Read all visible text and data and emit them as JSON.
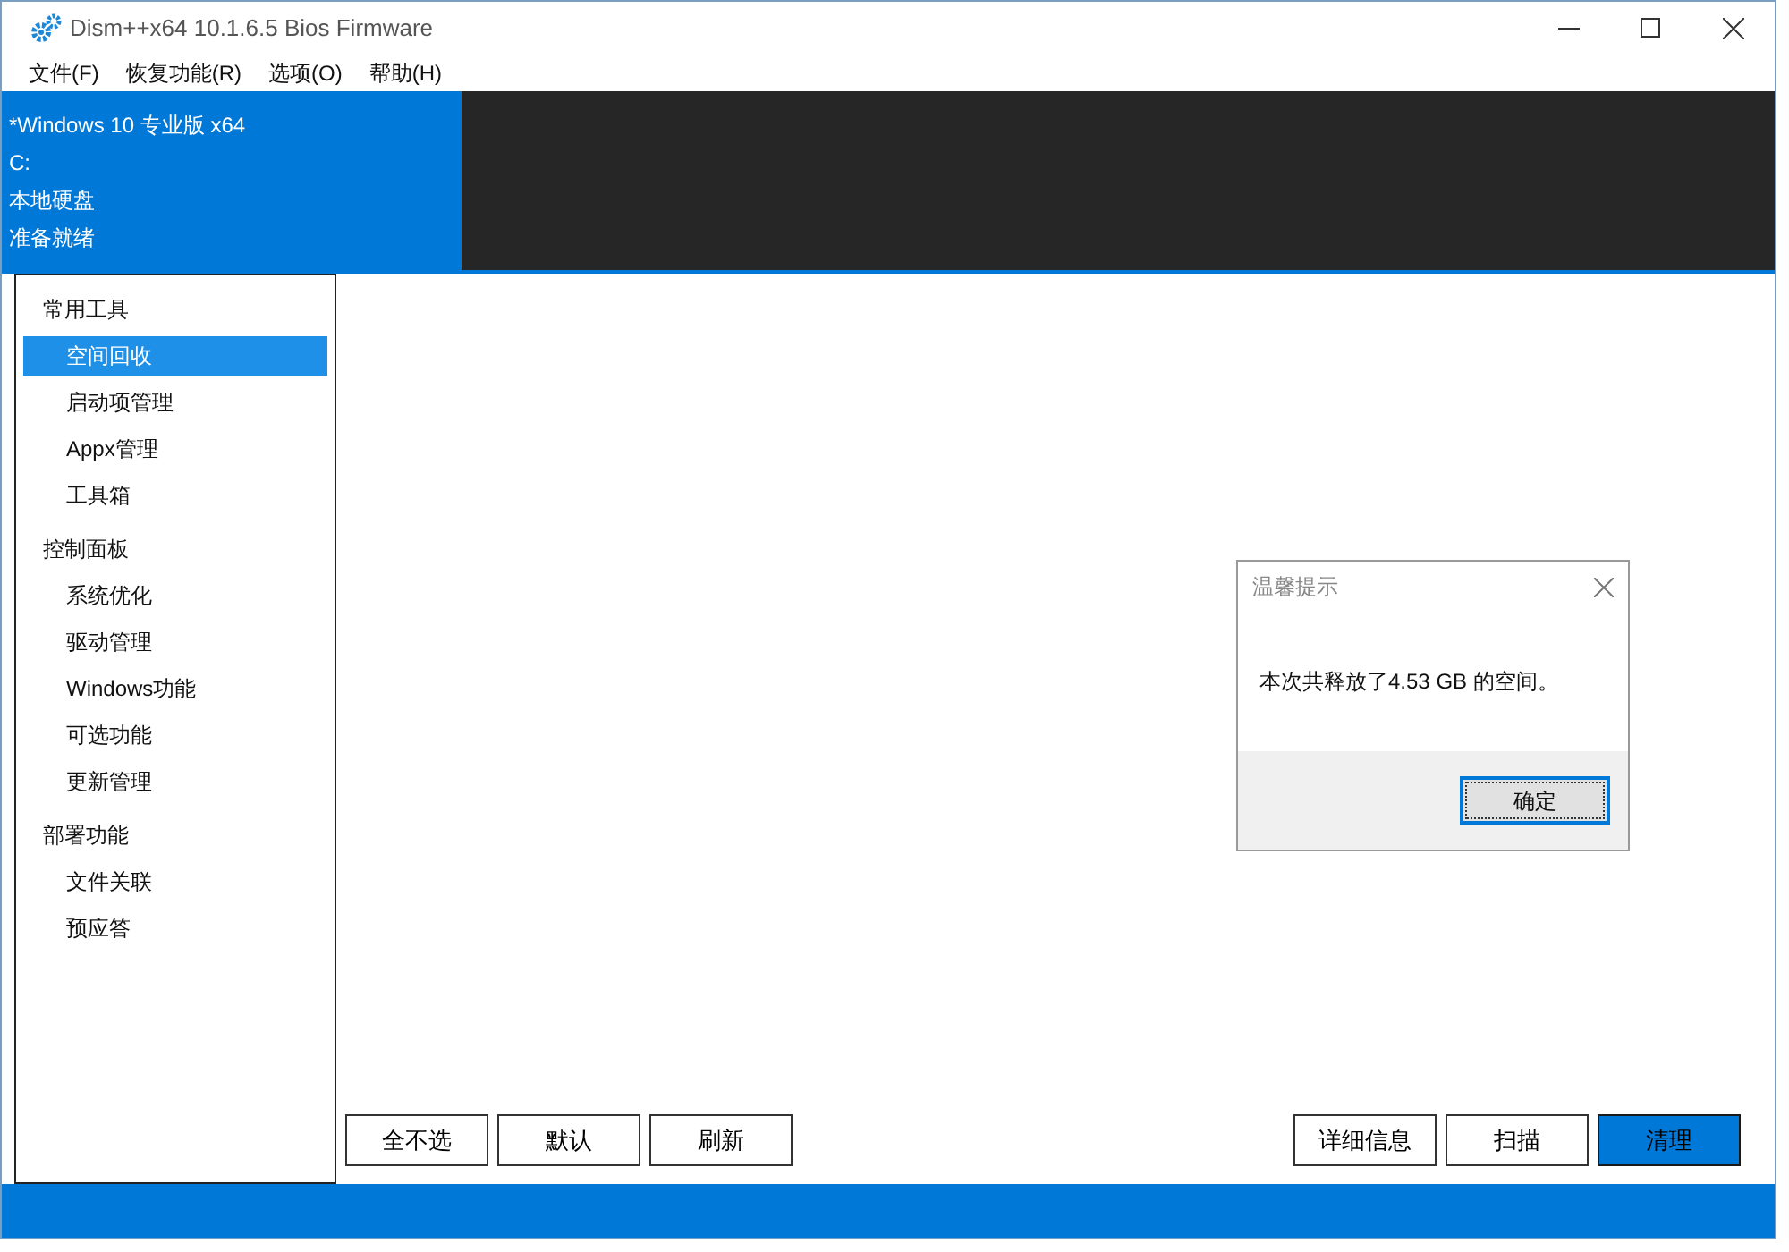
{
  "window": {
    "title": "Dism++x64 10.1.6.5 Bios Firmware"
  },
  "menu": [
    "文件(F)",
    "恢复功能(R)",
    "选项(O)",
    "帮助(H)"
  ],
  "image_info": [
    "*Windows 10 专业版 x64",
    "C:",
    "本地硬盘",
    "准备就绪"
  ],
  "sidebar": [
    {
      "label": "常用工具",
      "children": [
        {
          "label": "空间回收",
          "selected": true
        },
        {
          "label": "启动项管理",
          "selected": false
        },
        {
          "label": "Appx管理",
          "selected": false
        },
        {
          "label": "工具箱",
          "selected": false
        }
      ]
    },
    {
      "label": "控制面板",
      "children": [
        {
          "label": "系统优化",
          "selected": false
        },
        {
          "label": "驱动管理",
          "selected": false
        },
        {
          "label": "Windows功能",
          "selected": false
        },
        {
          "label": "可选功能",
          "selected": false
        },
        {
          "label": "更新管理",
          "selected": false
        }
      ]
    },
    {
      "label": "部署功能",
      "children": [
        {
          "label": "文件关联",
          "selected": false
        },
        {
          "label": "预应答",
          "selected": false
        }
      ]
    }
  ],
  "left_buttons": [
    {
      "label": "全不选",
      "primary": false
    },
    {
      "label": "默认",
      "primary": false
    },
    {
      "label": "刷新",
      "primary": false
    }
  ],
  "right_buttons": [
    {
      "label": "详细信息",
      "primary": false
    },
    {
      "label": "扫描",
      "primary": false
    },
    {
      "label": "清理",
      "primary": true
    }
  ],
  "dialog": {
    "title": "温馨提示",
    "message": "本次共释放了4.53 GB 的空间。",
    "button": "确定"
  }
}
